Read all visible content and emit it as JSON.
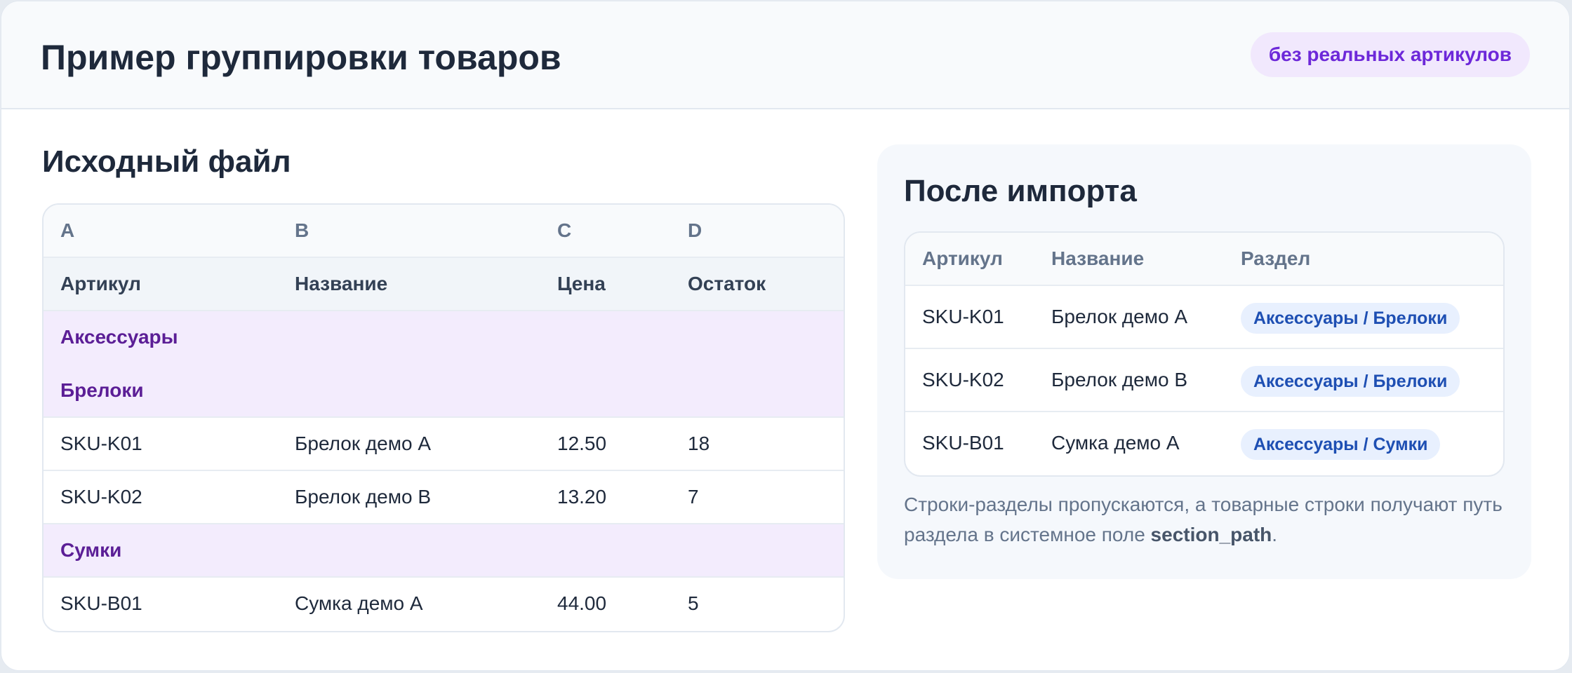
{
  "header": {
    "title": "Пример группировки товаров",
    "badge": "без реальных артикулов"
  },
  "source": {
    "title": "Исходный файл",
    "column_letters": [
      "A",
      "B",
      "C",
      "D"
    ],
    "headers": [
      "Артикул",
      "Название",
      "Цена",
      "Остаток"
    ],
    "group_rows": [
      "Аксессуары",
      "Брелоки",
      "Сумки"
    ],
    "rows": [
      [
        "SKU-K01",
        "Брелок демо A",
        "12.50",
        "18"
      ],
      [
        "SKU-K02",
        "Брелок демо B",
        "13.20",
        "7"
      ],
      [
        "SKU-B01",
        "Сумка демо A",
        "44.00",
        "5"
      ]
    ]
  },
  "result": {
    "title": "После импорта",
    "headers": [
      "Артикул",
      "Название",
      "Раздел"
    ],
    "rows": [
      [
        "SKU-K01",
        "Брелок демо A",
        "Аксессуары / Брелоки"
      ],
      [
        "SKU-K02",
        "Брелок демо B",
        "Аксессуары / Брелоки"
      ],
      [
        "SKU-B01",
        "Сумка демо A",
        "Аксессуары / Сумки"
      ]
    ],
    "note_before": "Строки-разделы пропускаются, а товарные строки получают путь раздела в системное поле ",
    "note_field": "section_path",
    "note_after": "."
  },
  "colors": {
    "group_bg": "#f3ecfd",
    "group_text": "#5b1e96",
    "pill_bg": "#e8f0fe",
    "pill_text": "#1e4fb3",
    "badge_bg": "#f1e8fd",
    "badge_text": "#6d28d9"
  }
}
